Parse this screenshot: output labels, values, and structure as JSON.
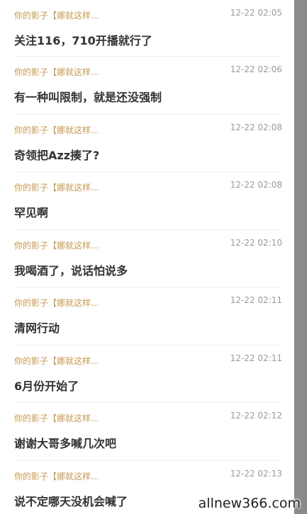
{
  "comments": [
    {
      "user": "你的影子【娜就这样...",
      "time": "12-22 02:05",
      "text": "关注116，710开播就行了"
    },
    {
      "user": "你的影子【娜就这样...",
      "time": "12-22 02:06",
      "text": "有一种叫限制，就是还没强制"
    },
    {
      "user": "你的影子【娜就这样...",
      "time": "12-22 02:08",
      "text": "奇领把Azz揍了?"
    },
    {
      "user": "你的影子【娜就这样...",
      "time": "12-22 02:08",
      "text": "罕见啊"
    },
    {
      "user": "你的影子【娜就这样...",
      "time": "12-22 02:10",
      "text": "我喝酒了，说话怕说多"
    },
    {
      "user": "你的影子【娜就这样...",
      "time": "12-22 02:11",
      "text": "清网行动"
    },
    {
      "user": "你的影子【娜就这样...",
      "time": "12-22 02:11",
      "text": "6月份开始了"
    },
    {
      "user": "你的影子【娜就这样...",
      "time": "12-22 02:12",
      "text": "谢谢大哥多喊几次吧"
    },
    {
      "user": "你的影子【娜就这样...",
      "time": "12-22 02:13",
      "text": "说不定哪天没机会喊了"
    }
  ],
  "watermark": "allnew366.com",
  "colors": {
    "username": "#c59a52",
    "timestamp": "#9a9a9a",
    "comment_text": "#333333",
    "side_bar": "#8a8a8a"
  }
}
